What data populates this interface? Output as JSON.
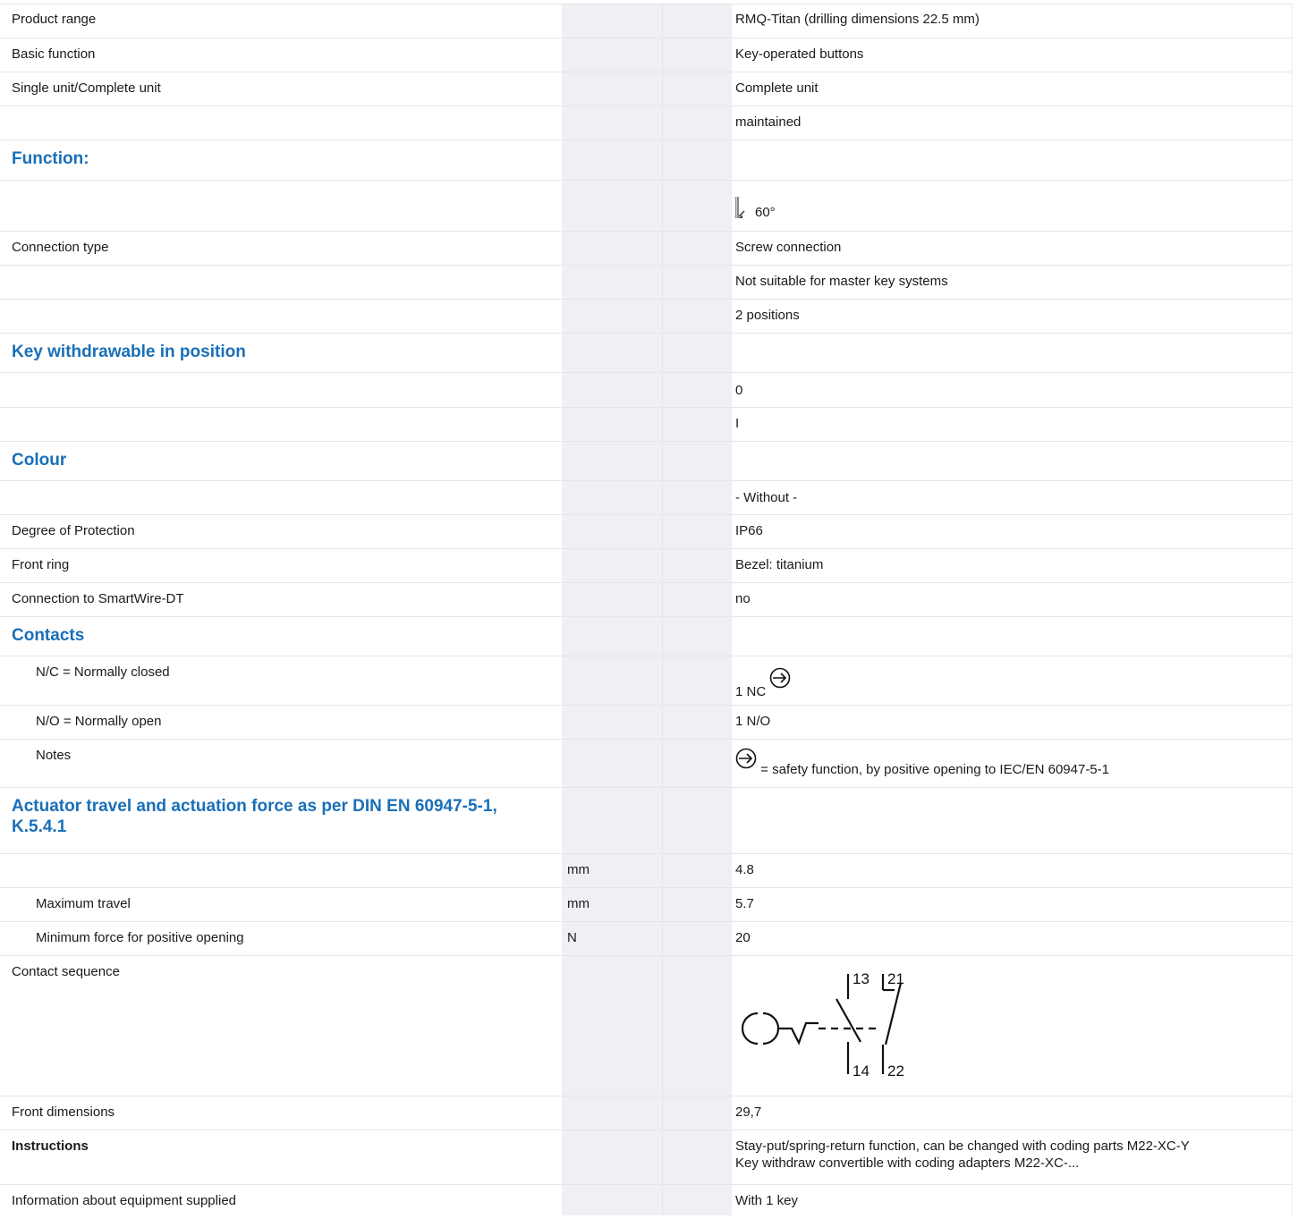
{
  "rows": {
    "product_range": {
      "label": "Product range",
      "value": "RMQ-Titan (drilling dimensions 22.5 mm)"
    },
    "basic_function": {
      "label": "Basic function",
      "value": "Key-operated buttons"
    },
    "single_complete": {
      "label": "Single unit/Complete unit",
      "value": "Complete unit"
    },
    "maintained": {
      "value": "maintained"
    },
    "function_heading": {
      "label": "Function:"
    },
    "function_angle": {
      "value": "60°",
      "icon": "key-position-icon"
    },
    "connection_type": {
      "label": "Connection type",
      "value": "Screw connection"
    },
    "master_key": {
      "value": "Not suitable for master key systems"
    },
    "positions": {
      "value": "2 positions"
    },
    "key_withdrawable_heading": {
      "label": "Key withdrawable in position"
    },
    "key_pos_0": {
      "value": "0"
    },
    "key_pos_1": {
      "value": "I"
    },
    "colour_heading": {
      "label": "Colour"
    },
    "colour_value": {
      "value": "- Without -"
    },
    "degree_protection": {
      "label": "Degree of Protection",
      "value": "IP66"
    },
    "front_ring": {
      "label": "Front ring",
      "value": "Bezel: titanium"
    },
    "smartwire": {
      "label": "Connection to SmartWire-DT",
      "value": "no"
    },
    "contacts_heading": {
      "label": "Contacts"
    },
    "nc": {
      "label": "N/C = Normally closed",
      "value": "1 NC",
      "icon": "safety-function-icon"
    },
    "no": {
      "label": "N/O = Normally open",
      "value": "1 N/O"
    },
    "notes": {
      "label": "Notes",
      "value": "= safety function, by positive opening to IEC/EN 60947-5-1",
      "icon": "safety-function-icon"
    },
    "actuator_heading": {
      "label": "Actuator travel and actuation force as per DIN EN 60947-5-1, K.5.4.1"
    },
    "travel_1": {
      "unit": "mm",
      "value": "4.8"
    },
    "max_travel": {
      "label": "Maximum travel",
      "unit": "mm",
      "value": "5.7"
    },
    "min_force": {
      "label": "Minimum force for positive opening",
      "unit": "N",
      "value": "20"
    },
    "contact_sequence": {
      "label": "Contact sequence",
      "terminals": [
        "13",
        "21",
        "14",
        "22"
      ],
      "icon": "contact-sequence-diagram"
    },
    "front_dimensions": {
      "label": "Front dimensions",
      "value": "29,7"
    },
    "instructions": {
      "label": "Instructions",
      "line1": "Stay-put/spring-return function, can be changed with coding parts M22-XC-Y",
      "line2": "Key withdraw convertible with coding adapters M22-XC-..."
    },
    "equipment": {
      "label": "Information about equipment supplied",
      "value": "With 1 key"
    }
  },
  "colors": {
    "heading": "#1a6fb8",
    "column_shade": "#eef0f3",
    "row_border": "#e4e6ea"
  }
}
